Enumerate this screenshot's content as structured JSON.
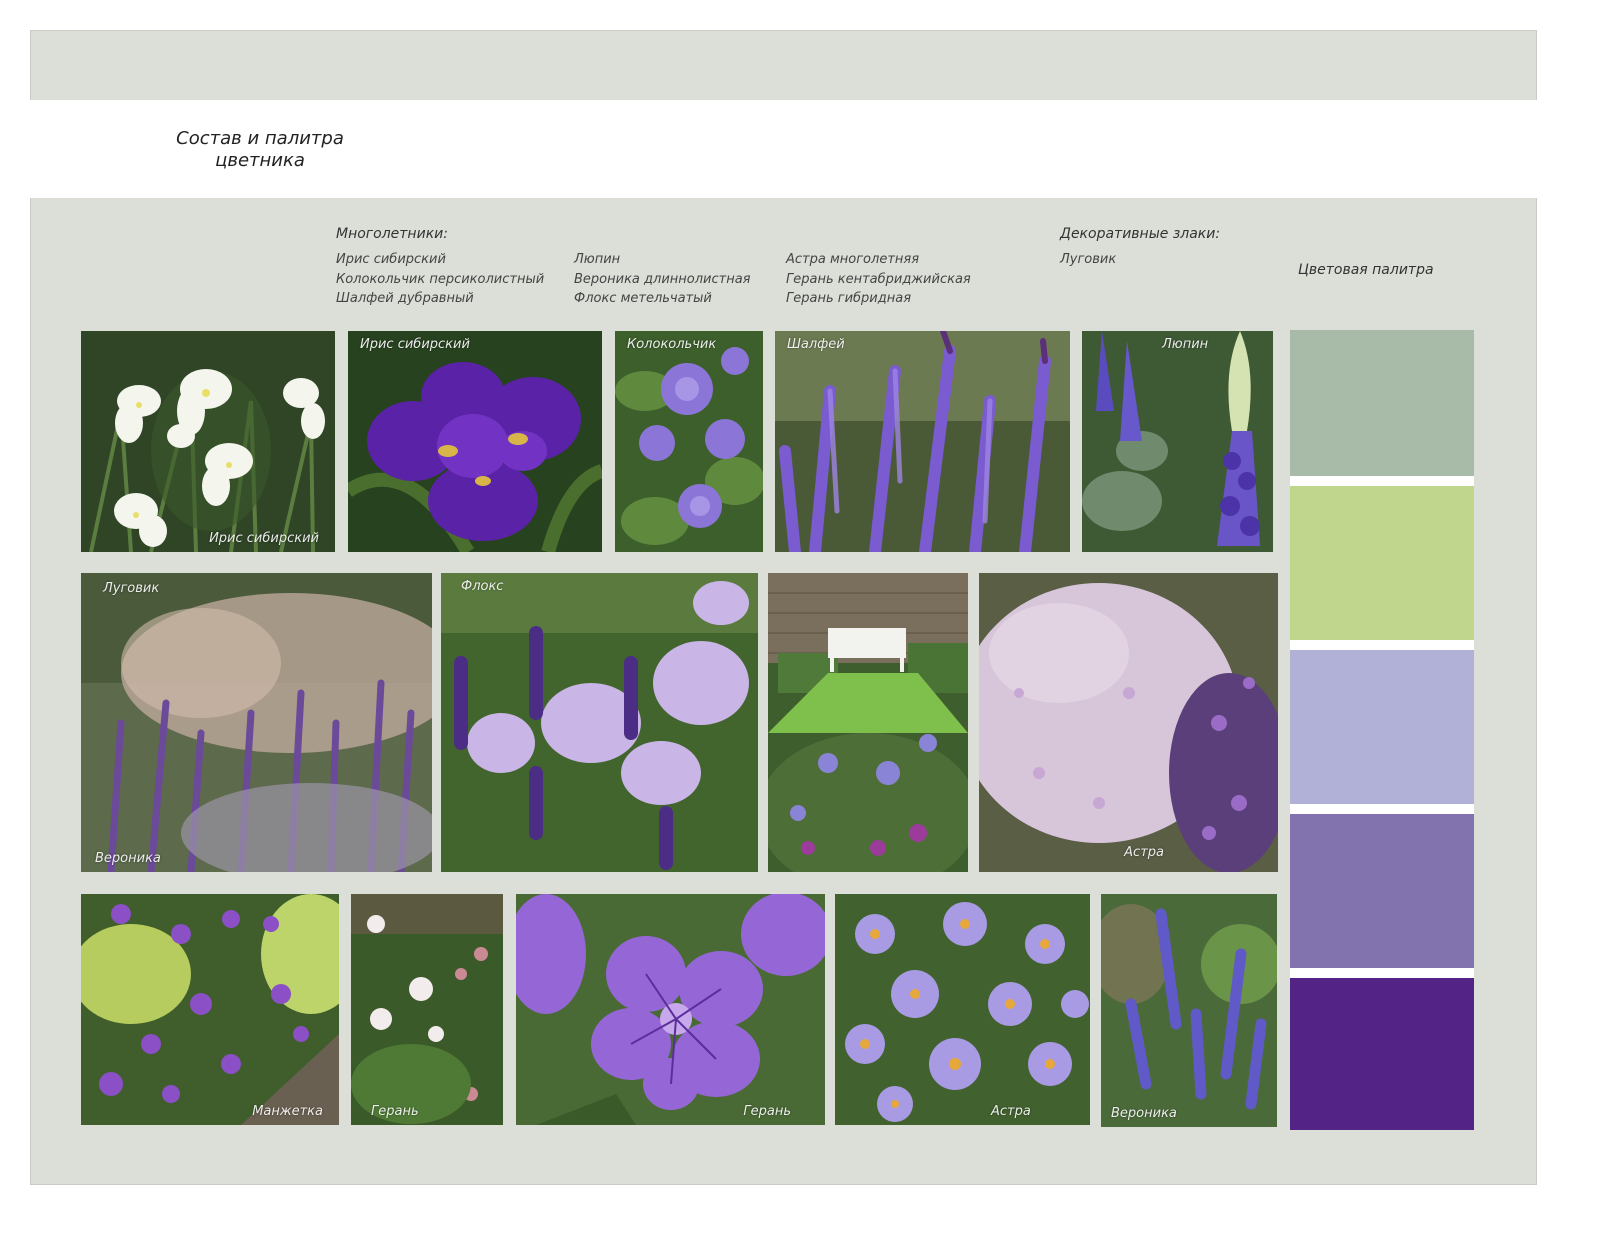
{
  "title": "Состав и палитра цветника",
  "perennials": {
    "heading": "Многолетники:",
    "col1": [
      "Ирис сибирский",
      "Колокольчик персиколистный",
      "Шалфей дубравный"
    ],
    "col2": [
      "Люпин",
      "Вероника длиннолистная",
      "Флокс метельчатый"
    ],
    "col3": [
      "Астра многолетняя",
      "Герань кентабриджийская",
      "Герань гибридная"
    ]
  },
  "grasses": {
    "heading": "Декоративные злаки:",
    "items": [
      "Луговик"
    ]
  },
  "palette": {
    "heading": "Цветовая палитра",
    "colors": [
      "#a8bba8",
      "#c0d68c",
      "#b1b0d6",
      "#8272ae",
      "#542386"
    ]
  },
  "captions": {
    "iris_white": "Ирис сибирский",
    "iris_purple": "Ирис сибирский",
    "bellflower": "Колокольчик",
    "salvia": "Шалфей",
    "lupin": "Люпин",
    "grass": "Луговик",
    "veronica_a": "Вероника",
    "phlox": "Флокс",
    "aster_a": "Астра",
    "alchemilla": "Манжетка",
    "geranium_a": "Герань",
    "geranium_b": "Герань",
    "aster_b": "Астра",
    "veronica_b": "Вероника"
  }
}
